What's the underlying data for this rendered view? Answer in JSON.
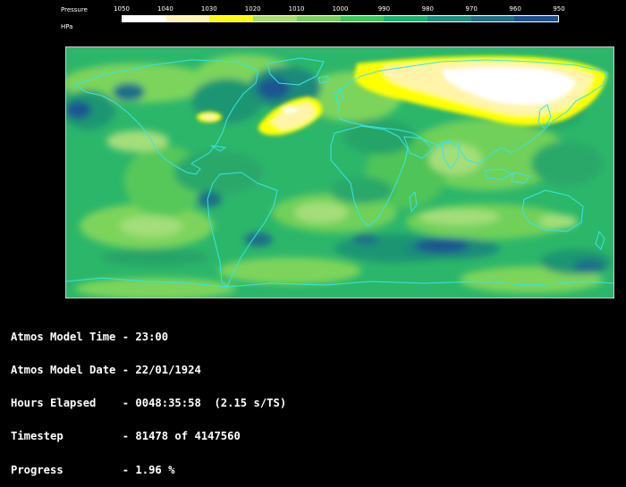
{
  "legend": {
    "title": "Pressure",
    "unit": "HPa",
    "ticks": [
      "1050",
      "1040",
      "1030",
      "1020",
      "1010",
      "1000",
      "990",
      "980",
      "970",
      "960",
      "950"
    ],
    "colors": [
      "#ffffff",
      "#fff5b0",
      "#ffff00",
      "#a5de6a",
      "#78d25a",
      "#38c858",
      "#1fae6e",
      "#1c8e7c",
      "#1e6f88",
      "#1a4f90",
      "#0c1a50"
    ]
  },
  "map": {
    "ocean_color": "#2cb66a",
    "coastline_color": "#36e6e6",
    "frame_color": "#cccccc"
  },
  "status": {
    "time": "Atmos Model Time - 23:00",
    "date": "Atmos Model Date - 22/01/1924",
    "elapsed": "Hours Elapsed    - 0048:35:58  (2.15 s/TS)",
    "timestep": "Timestep         - 81478 of 4147560",
    "progress": "Progress         - 1.96 %"
  }
}
